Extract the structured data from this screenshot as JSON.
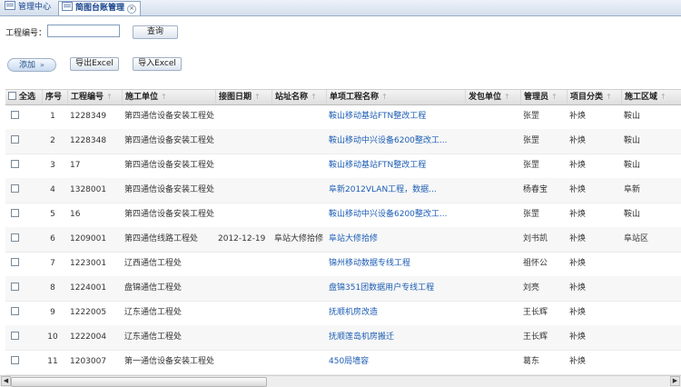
{
  "tabs": [
    {
      "label": "管理中心",
      "active": false
    },
    {
      "label": "简图台账管理",
      "active": true,
      "close": "×"
    }
  ],
  "search": {
    "label": "工程编号：",
    "value": "",
    "query_label": "查询"
  },
  "toolbar": {
    "add_label": "添加",
    "add_chevron": "»",
    "export_label": "导出Excel",
    "import_label": "导入Excel"
  },
  "table": {
    "columns": [
      "全选",
      "序号",
      "工程编号",
      "施工单位",
      "接图日期",
      "站址名称",
      "单项工程名称",
      "发包单位",
      "管理员",
      "项目分类",
      "施工区域"
    ],
    "sort_marker": "↑",
    "rows": [
      [
        "1",
        "1228349",
        "第四通信设备安装工程处",
        "",
        "",
        "鞍山移动基站FTN整改工程",
        "",
        "张罡",
        "补焕",
        "鞍山"
      ],
      [
        "2",
        "1228348",
        "第四通信设备安装工程处",
        "",
        "",
        "鞍山移动中兴设备6200整改工...",
        "",
        "张罡",
        "补焕",
        "鞍山"
      ],
      [
        "3",
        "17",
        "第四通信设备安装工程处",
        "",
        "",
        "鞍山移动基站FTN整改工程",
        "",
        "张罡",
        "补焕",
        "鞍山"
      ],
      [
        "4",
        "1328001",
        "第四通信设备安装工程处",
        "",
        "",
        "阜新2012VLAN工程，数据...",
        "",
        "杨春宝",
        "补焕",
        "阜新"
      ],
      [
        "5",
        "16",
        "第四通信设备安装工程处",
        "",
        "",
        "鞍山移动中兴设备6200整改工...",
        "",
        "张罡",
        "补焕",
        "鞍山"
      ],
      [
        "6",
        "1209001",
        "第四通信线路工程处",
        "2012-12-19",
        "阜站大修拾修",
        "阜站大修拾修",
        "",
        "刘书凯",
        "补焕",
        "阜站区"
      ],
      [
        "7",
        "1223001",
        "辽西通信工程处",
        "",
        "",
        "锦州移动数据专线工程",
        "",
        "祖怀公",
        "补焕",
        ""
      ],
      [
        "8",
        "1224001",
        "盘锦通信工程处",
        "",
        "",
        "盘锦351团数据用户专线工程",
        "",
        "刘亮",
        "补焕",
        ""
      ],
      [
        "9",
        "1222005",
        "辽东通信工程处",
        "",
        "",
        "抚顺机房改造",
        "",
        "王长辉",
        "补焕",
        ""
      ],
      [
        "10",
        "1222004",
        "辽东通信工程处",
        "",
        "",
        "抚顺莲岛机房搬迁",
        "",
        "王长辉",
        "补焕",
        ""
      ],
      [
        "11",
        "1203007",
        "第一通信设备安装工程处",
        "",
        "",
        "450局墙容",
        "",
        "葛东",
        "补焕",
        ""
      ]
    ]
  },
  "scrollbar": {
    "left": "◀",
    "right": "▶"
  }
}
